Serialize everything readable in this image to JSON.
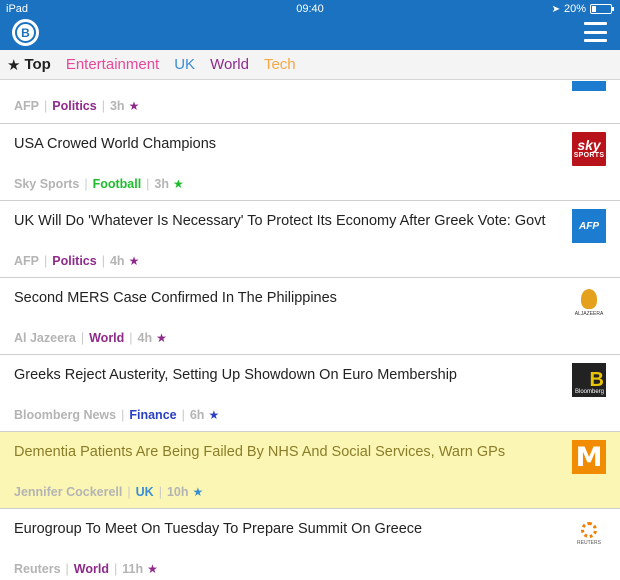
{
  "status": {
    "device": "iPad",
    "time": "09:40",
    "battery": "20%",
    "battery_level": 0.2
  },
  "app": {
    "logo_letter": "B"
  },
  "tabs": [
    {
      "label": "Top",
      "color": "#222222",
      "active": true
    },
    {
      "label": "Entertainment",
      "color": "#e8489a"
    },
    {
      "label": "UK",
      "color": "#3a8ed6"
    },
    {
      "label": "World",
      "color": "#8e2a8b"
    },
    {
      "label": "Tech",
      "color": "#f5a843"
    }
  ],
  "partial_item": {
    "source": "AFP",
    "category": "Politics",
    "category_color": "#8e2a8b",
    "time": "3h",
    "star_color": "#8e2a8b"
  },
  "items": [
    {
      "headline": "USA Crowed World Champions",
      "source": "Sky Sports",
      "category": "Football",
      "category_color": "#1ebd2e",
      "time": "3h",
      "star_color": "#1ebd2e",
      "thumb": "sky",
      "thumb_text": "sky",
      "thumb_sub": "SPORTS"
    },
    {
      "headline": "UK Will Do 'Whatever Is Necessary' To Protect Its Economy After Greek Vote: Govt",
      "source": "AFP",
      "category": "Politics",
      "category_color": "#8e2a8b",
      "time": "4h",
      "star_color": "#8e2a8b",
      "thumb": "afp",
      "thumb_text": "AFP"
    },
    {
      "headline": "Second MERS Case Confirmed In The Philippines",
      "source": "Al Jazeera",
      "category": "World",
      "category_color": "#8e2a8b",
      "time": "4h",
      "star_color": "#8e2a8b",
      "thumb": "aj",
      "thumb_sub": "ALJAZEERA"
    },
    {
      "headline": "Greeks Reject Austerity, Setting Up Showdown On Euro Membership",
      "source": "Bloomberg News",
      "category": "Finance",
      "category_color": "#2b3fc4",
      "time": "6h",
      "star_color": "#2b3fc4",
      "thumb": "bloom",
      "thumb_text": "B",
      "thumb_sub": "Bloomberg"
    },
    {
      "headline": "Dementia Patients Are Being Failed By NHS And Social Services, Warn GPs",
      "source": "Jennifer Cockerell",
      "category": "UK",
      "category_color": "#3a8ed6",
      "time": "10h",
      "star_color": "#3a8ed6",
      "thumb": "metro",
      "thumb_text": "M",
      "highlight": true
    },
    {
      "headline": "Eurogroup To Meet On Tuesday To Prepare Summit On Greece",
      "source": "Reuters",
      "category": "World",
      "category_color": "#8e2a8b",
      "time": "11h",
      "star_color": "#8e2a8b",
      "thumb": "reuters",
      "thumb_sub": "REUTERS"
    }
  ]
}
